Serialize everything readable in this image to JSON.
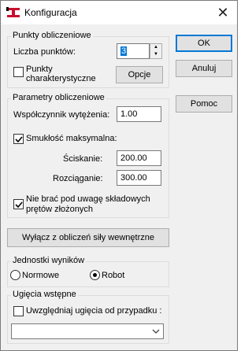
{
  "window": {
    "title": "Konfiguracja",
    "close_glyph": "✕"
  },
  "groups": {
    "punkty": {
      "label": "Punkty obliczeniowe",
      "liczba_label": "Liczba punktów:",
      "liczba_value": "3",
      "punkty_char_line1": "Punkty",
      "punkty_char_line2": "charakterystyczne",
      "punkty_char_checked": false,
      "opcje_button": "Opcje"
    },
    "parametry": {
      "label": "Parametry obliczeniowe",
      "wspolczynnik_label": "Współczynnik wytężenia:",
      "wspolczynnik_value": "1.00",
      "smuklosc_label": "Smukłość maksymalna:",
      "smuklosc_checked": true,
      "sciskanie_label": "Ściskanie:",
      "sciskanie_value": "200.00",
      "rozciaganie_label": "Rozciąganie:",
      "rozciaganie_value": "300.00",
      "nie_brac_line1": "Nie brać pod uwagę składowych",
      "nie_brac_line2": "prętów złożonych",
      "nie_brac_checked": true
    },
    "jednostki": {
      "label": "Jednostki wyników",
      "options": [
        {
          "label": "Normowe",
          "selected": false
        },
        {
          "label": "Robot",
          "selected": true
        }
      ]
    },
    "ugiecia": {
      "label": "Ugięcia wstępne",
      "uwzgledniaj_label": "Uwzględniaj ugięcia od przypadku :",
      "uwzgledniaj_checked": false,
      "dropdown_value": ""
    }
  },
  "buttons": {
    "ok": "OK",
    "anuluj": "Anuluj",
    "pomoc": "Pomoc",
    "wylacz": "Wyłącz z obliczeń siły wewnętrzne"
  },
  "colors": {
    "accent": "#0078d7",
    "icon_red": "#c8102e"
  }
}
